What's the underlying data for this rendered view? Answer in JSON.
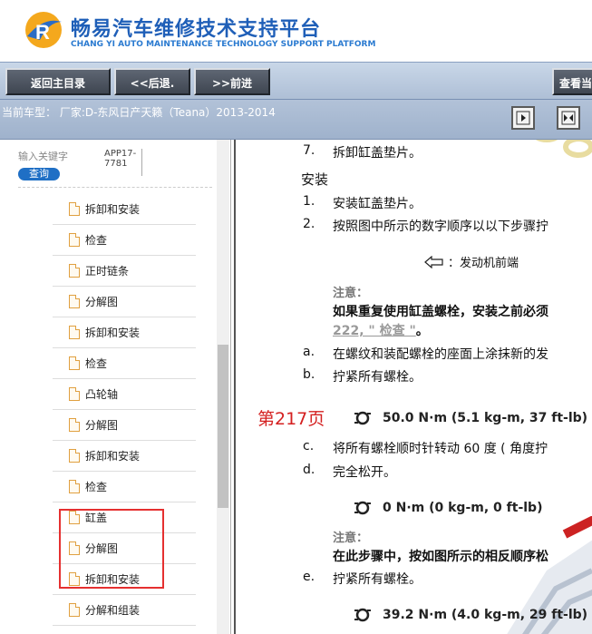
{
  "header": {
    "title": "畅易汽车维修技术支持平台",
    "subtitle": "CHANG YI AUTO MAINTENANCE TECHNOLOGY SUPPORT PLATFORM"
  },
  "nav": {
    "home": "返回主目录",
    "back": "<<后退.",
    "forward": ">>前进",
    "view": "查看当"
  },
  "model_bar": {
    "current_model": "当前车型： 厂家:D-东风日产天籁（Teana）2013-2014"
  },
  "sidebar": {
    "search_label": "输入关键字",
    "search_button": "查询",
    "search_value": "APP17-7781",
    "items": [
      {
        "label": "拆卸和安装"
      },
      {
        "label": "检查"
      },
      {
        "label": "正时链条"
      },
      {
        "label": "分解图"
      },
      {
        "label": "拆卸和安装"
      },
      {
        "label": "检查"
      },
      {
        "label": "凸轮轴"
      },
      {
        "label": "分解图"
      },
      {
        "label": "拆卸和安装"
      },
      {
        "label": "检查"
      },
      {
        "label": "缸盖"
      },
      {
        "label": "分解图"
      },
      {
        "label": "拆卸和安装"
      },
      {
        "label": "分解和组装"
      }
    ]
  },
  "content": {
    "step7": "7.",
    "step7_text": "拆卸缸盖垫片。",
    "install_heading": "安装",
    "step1": "1.",
    "step1_text": "安装缸盖垫片。",
    "step2": "2.",
    "step2_text": "按照图中所示的数字顺序以以下步骤拧",
    "front_note": "：发动机前端",
    "caution1_label": "注意：",
    "caution1_text": "如果重复使用缸盖螺栓，安装之前必须",
    "caution1_link": "222, \" 检查 \"",
    "caution1_end": "。",
    "a_label": "a.",
    "a_text": "在螺纹和装配螺栓的座面上涂抹新的发",
    "b_label": "b.",
    "b_text": "拧紧所有螺栓。",
    "page_mark": "第217页",
    "torque1": "50.0 N·m (5.1 kg-m, 37 ft-lb)",
    "c_label": "c.",
    "c_text": "将所有螺栓顺时针转动 60 度 ( 角度拧",
    "d_label": "d.",
    "d_text": "完全松开。",
    "torque2": "0 N·m (0 kg-m, 0 ft-lb)",
    "caution2_label": "注意：",
    "caution2_text": "在此步骤中，按如图所示的相反顺序松",
    "e_label": "e.",
    "e_text": "拧紧所有螺栓。",
    "torque3": "39.2 N·m (4.0 kg-m, 29 ft-lb)"
  }
}
